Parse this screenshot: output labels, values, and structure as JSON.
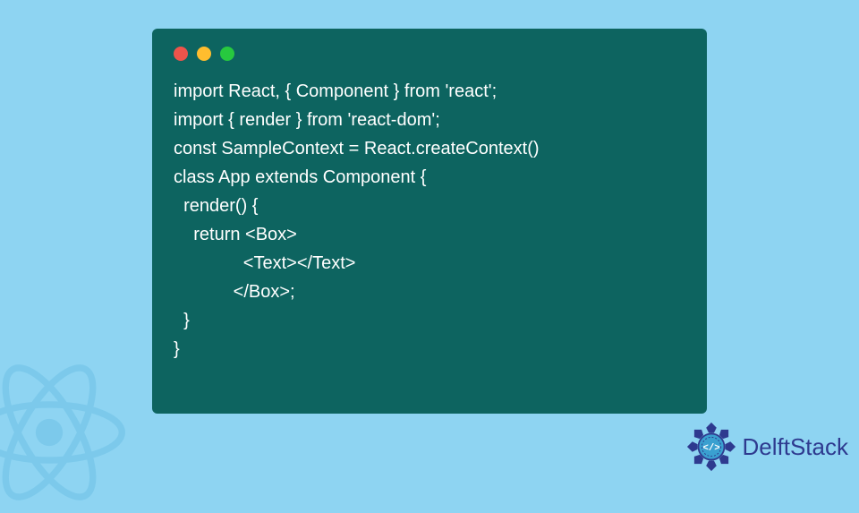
{
  "code": {
    "lines": [
      "import React, { Component } from 'react';",
      "import { render } from 'react-dom';",
      "const SampleContext = React.createContext()",
      "class App extends Component {",
      "  render() {",
      "    return <Box>",
      "              <Text></Text>",
      "            </Box>;",
      "  }",
      "}"
    ]
  },
  "brand": {
    "name": "DelftStack"
  },
  "colors": {
    "background": "#8ed4f2",
    "window": "#0d6460",
    "brand": "#2e3a8f"
  }
}
